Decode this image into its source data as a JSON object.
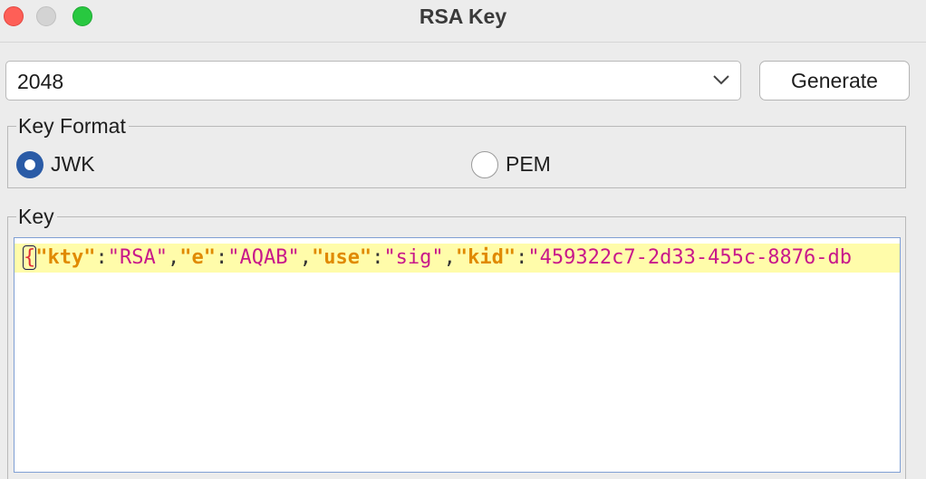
{
  "window": {
    "title": "RSA Key"
  },
  "key_size": {
    "value": "2048"
  },
  "toolbar": {
    "generate_label": "Generate"
  },
  "key_format": {
    "legend": "Key Format",
    "options": [
      {
        "label": "JWK",
        "checked": true
      },
      {
        "label": "PEM",
        "checked": false
      }
    ]
  },
  "key": {
    "legend": "Key",
    "tokens": {
      "open_brace": "{",
      "k1": "\"kty\"",
      "v1": "\"RSA\"",
      "k2": "\"e\"",
      "v2": "\"AQAB\"",
      "k3": "\"use\"",
      "v3": "\"sig\"",
      "k4": "\"kid\"",
      "v4": "\"459322c7-2d33-455c-8876-db",
      "colon": ":",
      "comma": ","
    }
  },
  "colors": {
    "accent": "#2a5ba6",
    "close": "#fe5f57",
    "maximize": "#28c840",
    "json_key": "#e08a00",
    "json_string": "#c8188a",
    "current_line": "#fffcaa"
  }
}
